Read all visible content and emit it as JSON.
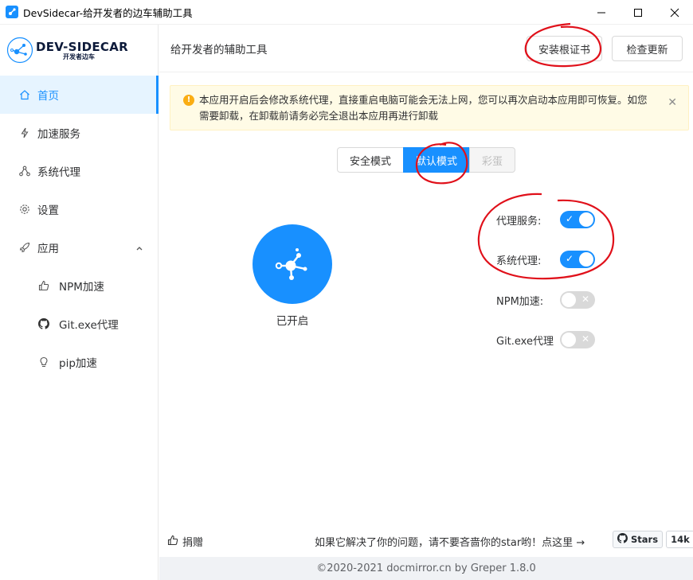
{
  "window": {
    "title": "DevSidecar-给开发者的边车辅助工具"
  },
  "logo": {
    "name": "DEV-SIDECAR",
    "tagline": "开发者边车"
  },
  "sidebar": {
    "items": [
      {
        "label": "首页",
        "icon": "home-icon",
        "active": true
      },
      {
        "label": "加速服务",
        "icon": "lightning-icon"
      },
      {
        "label": "系统代理",
        "icon": "network-icon"
      },
      {
        "label": "设置",
        "icon": "gear-icon"
      },
      {
        "label": "应用",
        "icon": "rocket-icon",
        "expanded": true
      }
    ],
    "sub_items": [
      {
        "label": "NPM加速",
        "icon": "thumbs-up-icon"
      },
      {
        "label": "Git.exe代理",
        "icon": "github-icon"
      },
      {
        "label": "pip加速",
        "icon": "bulb-icon"
      }
    ]
  },
  "header": {
    "subtitle": "给开发者的辅助工具",
    "install_cert_label": "安装根证书",
    "check_update_label": "检查更新"
  },
  "alert": {
    "text": "本应用开启后会修改系统代理，直接重启电脑可能会无法上网，您可以再次启动本应用即可恢复。如您需要卸载，在卸载前请务必完全退出本应用再进行卸载"
  },
  "modes": {
    "options": [
      "安全模式",
      "默认模式",
      "彩蛋"
    ],
    "selected": "默认模式"
  },
  "power": {
    "status_label": "已开启"
  },
  "switches": [
    {
      "label": "代理服务:",
      "on": true
    },
    {
      "label": "系统代理:",
      "on": true
    },
    {
      "label": "NPM加速:",
      "on": false
    },
    {
      "label": "Git.exe代理",
      "on": false
    }
  ],
  "footer": {
    "donate_label": "捐赠",
    "hint": "如果它解决了你的问题，请不要吝啬你的star哟！点这里 →",
    "github_stars_label": "Stars",
    "github_stars_count": "14k",
    "copyright": "©2020-2021 docmirror.cn by Greper 1.8.0"
  },
  "colors": {
    "accent": "#1890ff",
    "annotation": "#e0101a"
  }
}
